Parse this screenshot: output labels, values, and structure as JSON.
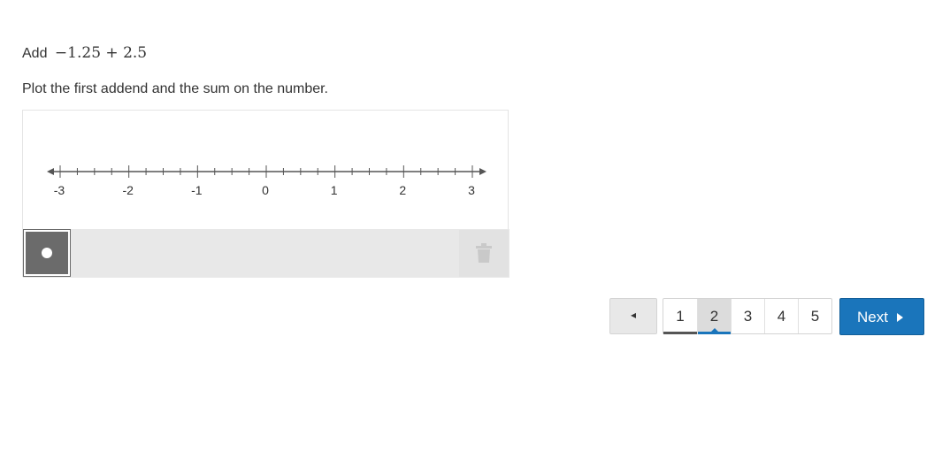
{
  "question": {
    "prefix": "Add",
    "expression": "−1.25 + 2.5",
    "instruction": "Plot the first addend and the sum on the number."
  },
  "number_line": {
    "min": -3,
    "max": 3,
    "minor_step": 0.25,
    "labels": [
      "-3",
      "-2",
      "-1",
      "0",
      "1",
      "2",
      "3"
    ],
    "axis_color": "#555555"
  },
  "toolbar": {
    "point_tool_icon": "point-dot-icon",
    "delete_tool_icon": "trash-icon"
  },
  "pager": {
    "prev_symbol": "◂",
    "pages": [
      "1",
      "2",
      "3",
      "4",
      "5"
    ],
    "current_page": "2",
    "next_label": "Next",
    "accent": "#1a75bb"
  }
}
